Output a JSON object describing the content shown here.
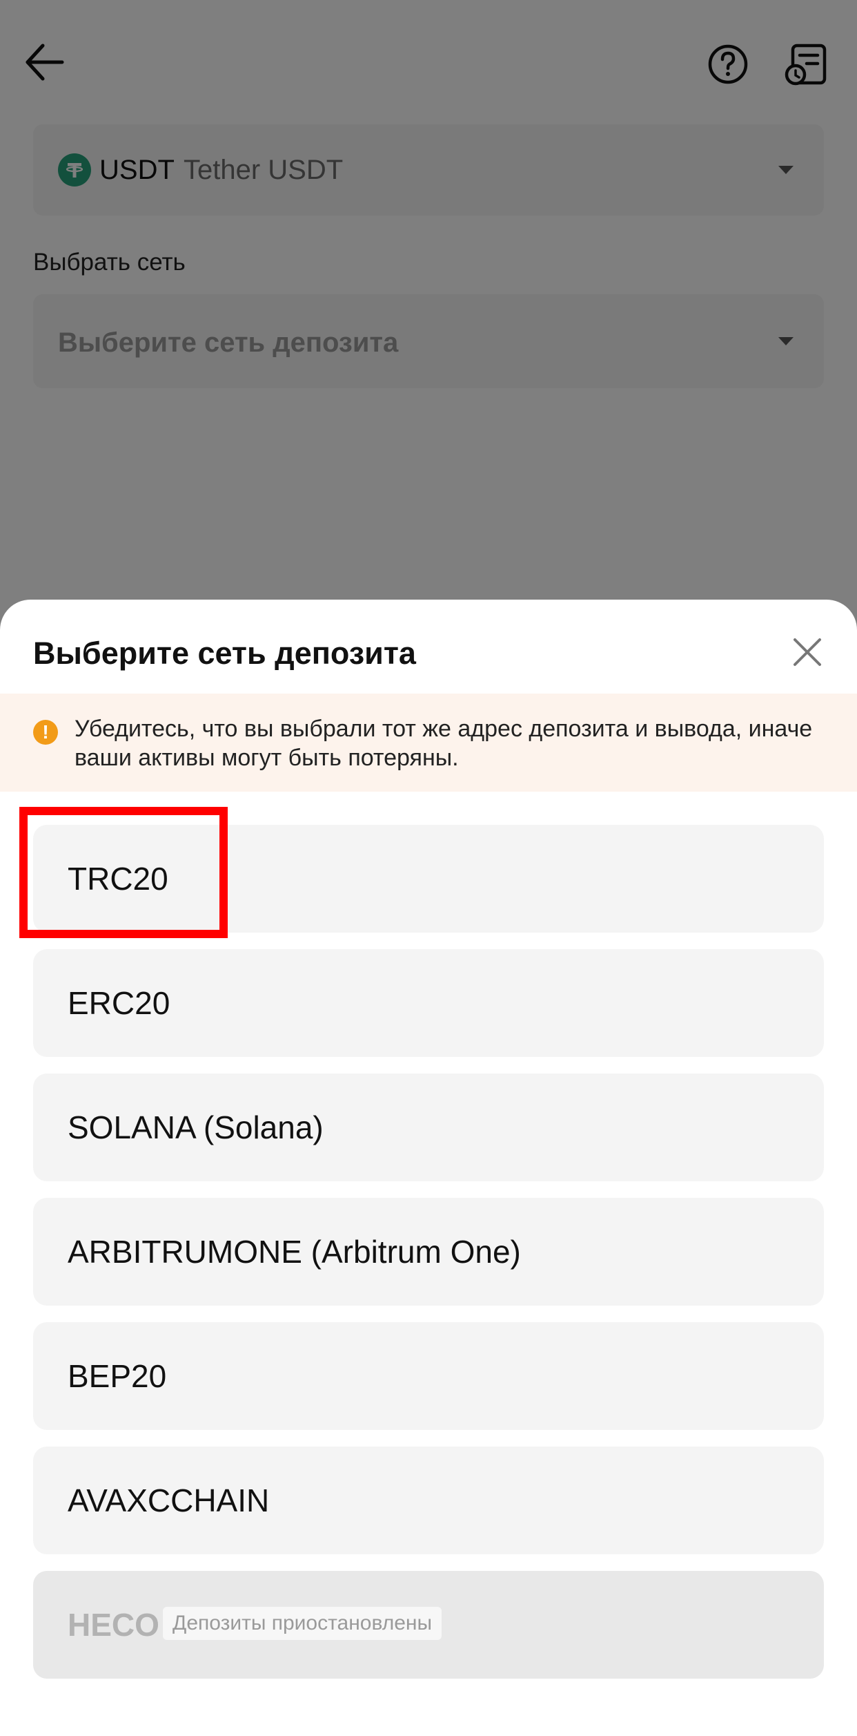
{
  "header": {
    "back_icon": "arrow-left-icon",
    "help_icon": "question-circle-icon",
    "history_icon": "deposit-history-icon"
  },
  "coin": {
    "symbol": "USDT",
    "name": "Tether USDT",
    "logo_color": "#26a17b"
  },
  "network_field": {
    "label": "Выбрать сеть",
    "placeholder": "Выберите сеть депозита"
  },
  "sheet": {
    "title": "Выберите сеть депозита",
    "warning": "Убедитесь, что вы выбрали тот же адрес депозита и вывода, иначе ваши активы могут быть потеряны.",
    "warning_color": "#f29b18",
    "networks": [
      {
        "label": "TRC20",
        "enabled": true,
        "highlighted": true
      },
      {
        "label": "ERC20",
        "enabled": true
      },
      {
        "label": "SOLANA (Solana)",
        "enabled": true
      },
      {
        "label": "ARBITRUMONE (Arbitrum One)",
        "enabled": true
      },
      {
        "label": "BEP20",
        "enabled": true
      },
      {
        "label": "AVAXCCHAIN",
        "enabled": true
      },
      {
        "label": "HECO",
        "enabled": false,
        "badge": "Депозиты приостановлены"
      }
    ]
  },
  "colors": {
    "highlight": "#ff0000",
    "warning_bg": "#fdf3ec"
  }
}
